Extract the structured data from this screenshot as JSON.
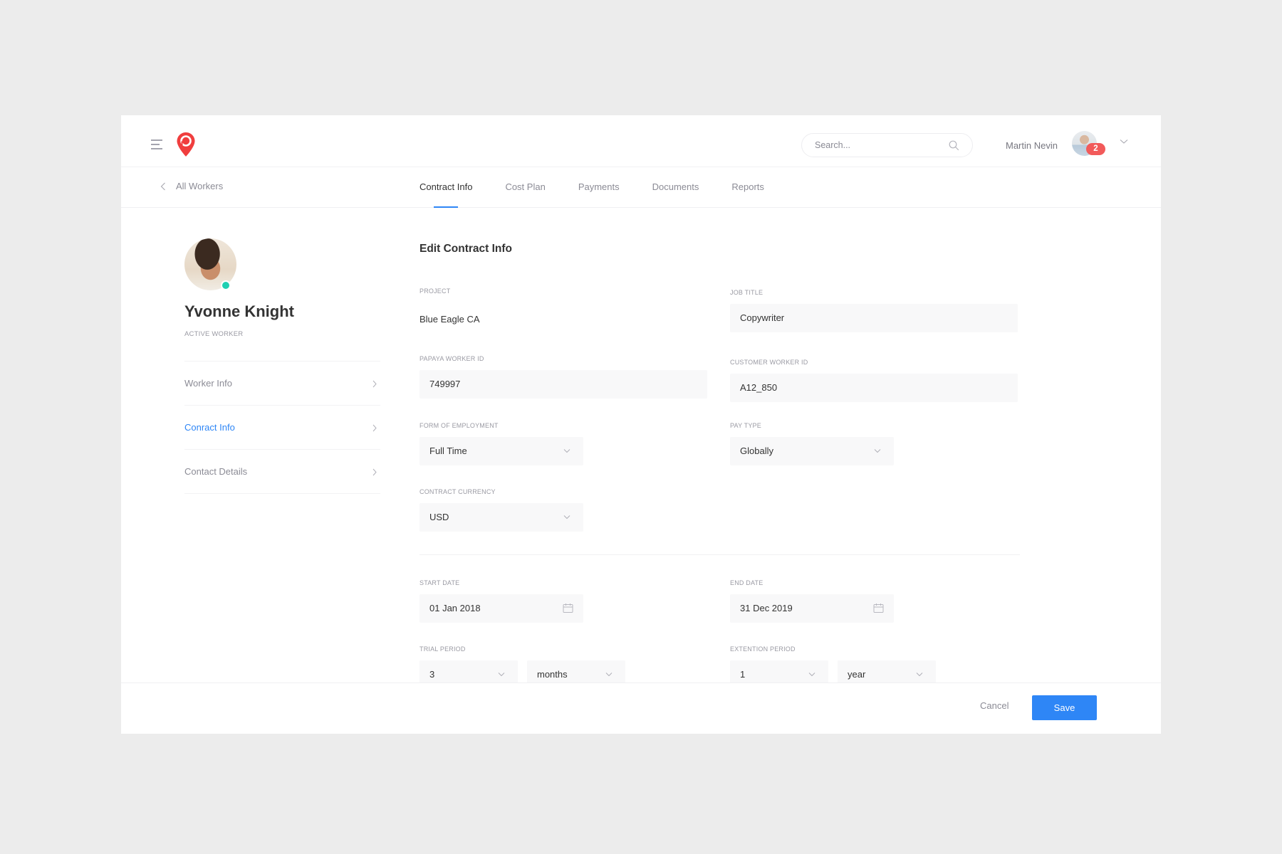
{
  "header": {
    "search_placeholder": "Search...",
    "user_name": "Martin Nevin",
    "notification_count": "2"
  },
  "subnav": {
    "back_label": "All Workers",
    "tabs": [
      {
        "label": "Contract Info",
        "active": true
      },
      {
        "label": "Cost Plan",
        "active": false
      },
      {
        "label": "Payments",
        "active": false
      },
      {
        "label": "Documents",
        "active": false
      },
      {
        "label": "Reports",
        "active": false
      }
    ]
  },
  "profile": {
    "name": "Yvonne Knight",
    "role": "ACTIVE WORKER",
    "status": "online",
    "menu": [
      {
        "label": "Worker Info",
        "active": false
      },
      {
        "label": "Conract Info",
        "active": true
      },
      {
        "label": "Contact Details",
        "active": false
      }
    ]
  },
  "form": {
    "title": "Edit Contract Info",
    "project": {
      "label": "PROJECT",
      "value": "Blue Eagle CA"
    },
    "job_title": {
      "label": "JOB TITLE",
      "value": "Copywriter"
    },
    "papaya_worker_id": {
      "label": "PAPAYA WORKER ID",
      "value": "749997"
    },
    "customer_worker_id": {
      "label": "CUSTOMER WORKER ID",
      "value": "A12_850"
    },
    "form_of_employment": {
      "label": "FORM OF EMPLOYMENT",
      "value": "Full Time"
    },
    "pay_type": {
      "label": "PAY TYPE",
      "value": "Globally"
    },
    "contract_currency": {
      "label": "CONTRACT CURRENCY",
      "value": "USD"
    },
    "start_date": {
      "label": "START DATE",
      "value": "01 Jan 2018"
    },
    "end_date": {
      "label": "END DATE",
      "value": "31 Dec 2019"
    },
    "trial_period": {
      "label": "TRIAL PERIOD",
      "amount": "3",
      "unit": "months"
    },
    "extension_period": {
      "label": "EXTENTION PERIOD",
      "amount": "1",
      "unit": "year"
    }
  },
  "footer": {
    "cancel_label": "Cancel",
    "save_label": "Save"
  },
  "colors": {
    "accent": "#2e86f6",
    "brand": "#f03e3e",
    "badge": "#f25a5a",
    "status_online": "#1fd0b2"
  }
}
